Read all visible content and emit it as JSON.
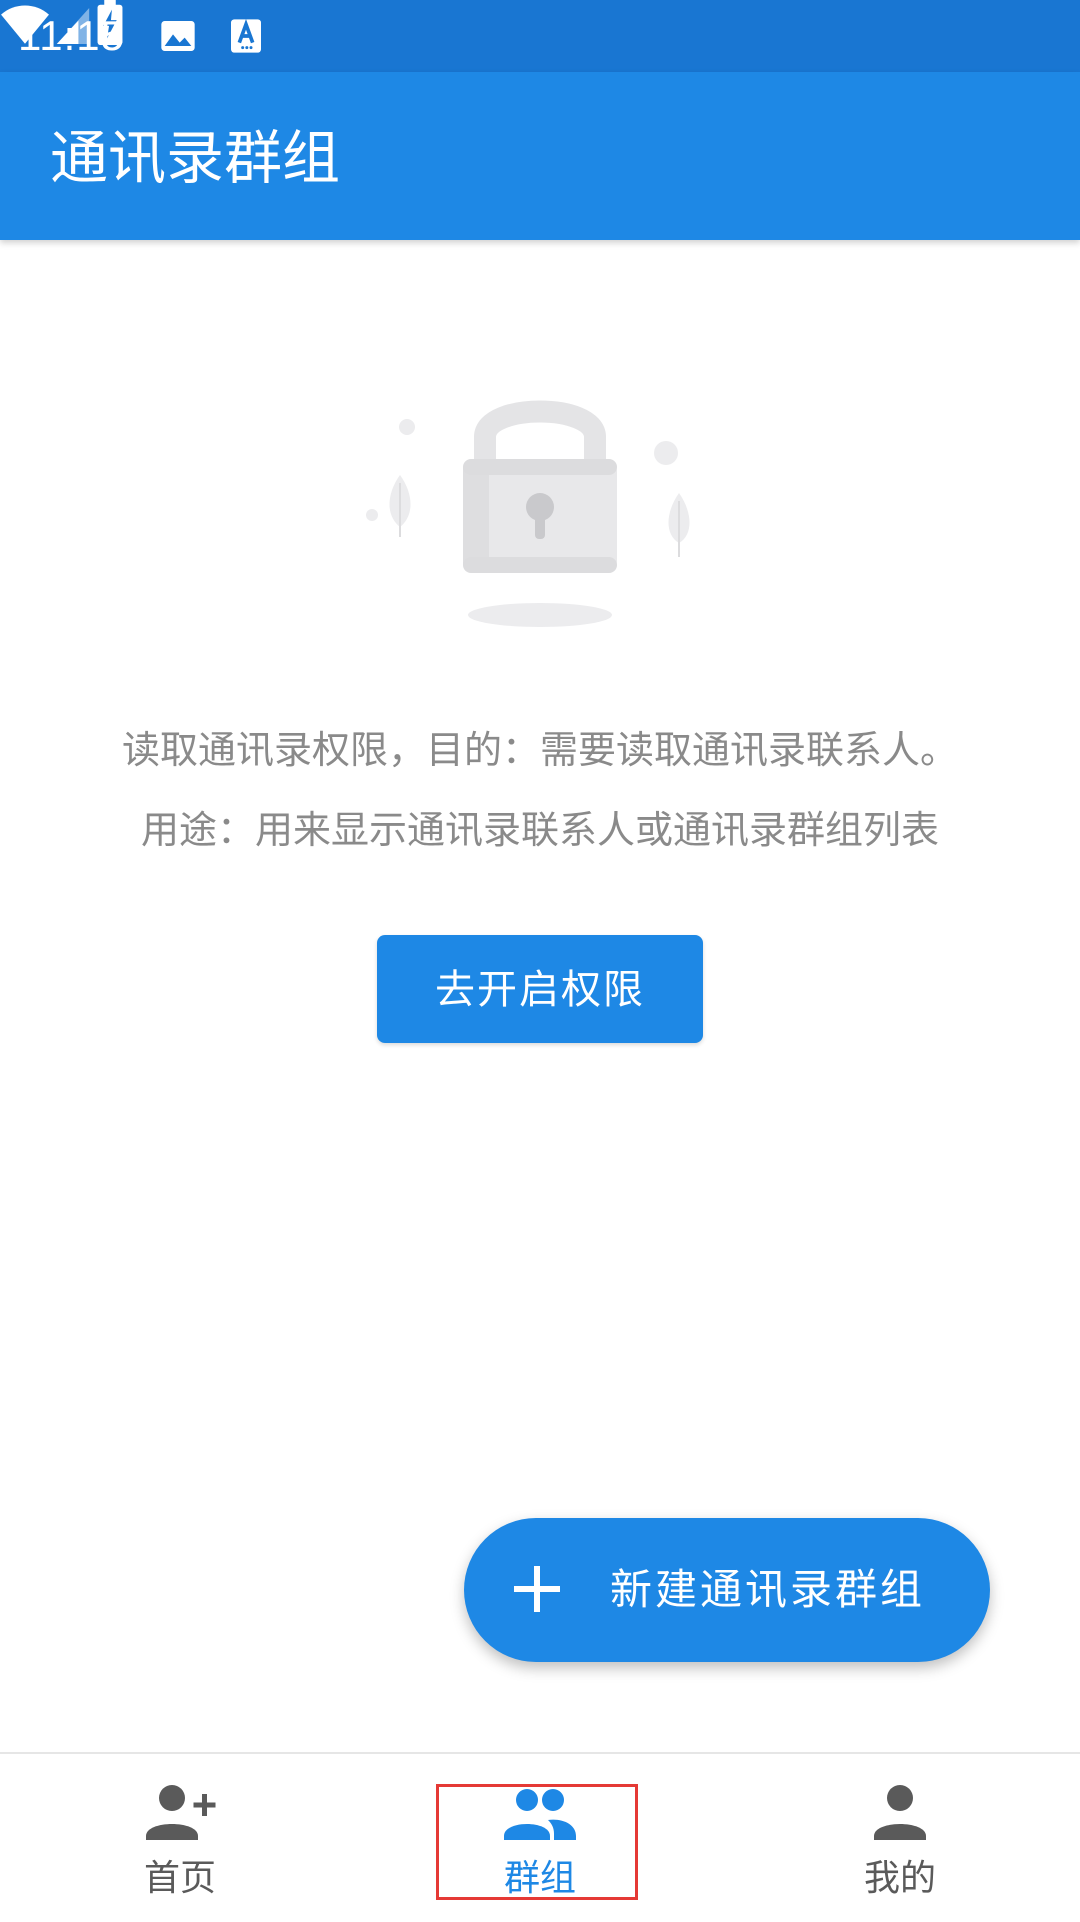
{
  "status_bar": {
    "time": "11:15",
    "icons": [
      "gallery-icon",
      "font-a-icon",
      "wifi-icon",
      "signal-icon",
      "battery-charging-icon"
    ]
  },
  "app_bar": {
    "title": "通讯录群组"
  },
  "empty_state": {
    "illustration": "lock-icon",
    "description_line1": "读取通讯录权限，目的：需要读取通讯录联系人。",
    "description_line2": "用途：用来显示通讯录联系人或通讯录群组列表",
    "grant_button_label": "去开启权限"
  },
  "fab": {
    "icon": "plus-icon",
    "label": "新建通讯录群组"
  },
  "bottom_nav": {
    "items": [
      {
        "label": "首页",
        "icon": "add-person-icon",
        "active": false
      },
      {
        "label": "群组",
        "icon": "group-icon",
        "active": true
      },
      {
        "label": "我的",
        "icon": "person-icon",
        "active": false
      }
    ]
  },
  "colors": {
    "status_bar": "#1976d2",
    "primary": "#1e88e5",
    "text_gray": "#8a8a8a",
    "nav_inactive": "#5a5a5a",
    "highlight": "#e53935"
  }
}
